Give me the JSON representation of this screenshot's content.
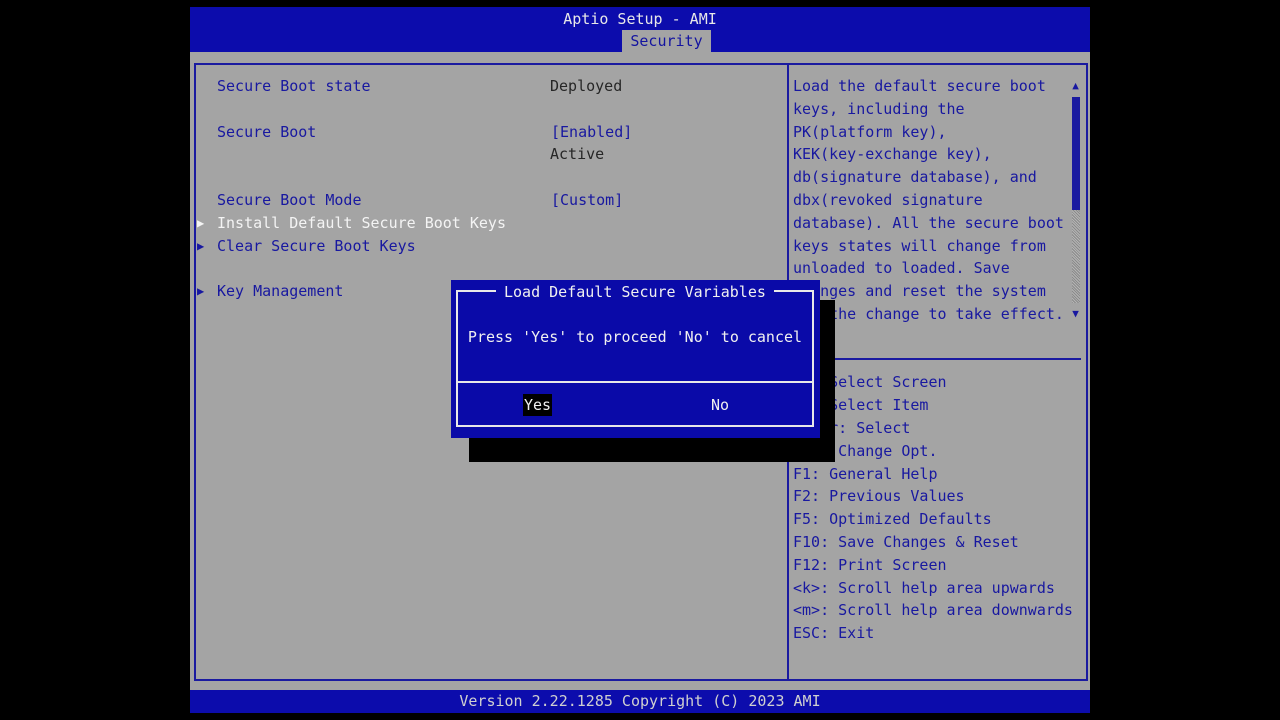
{
  "header": {
    "title": "Aptio Setup - AMI",
    "active_tab": "Security"
  },
  "settings": [
    {
      "label": "Secure Boot state",
      "value": "Deployed"
    },
    {
      "label": "Secure Boot",
      "value": "[Enabled]",
      "status": "Active"
    },
    {
      "label": "Secure Boot Mode",
      "value": "[Custom]"
    },
    {
      "label": "Install Default Secure Boot Keys",
      "submenu": true,
      "selected": true
    },
    {
      "label": "Clear Secure Boot Keys",
      "submenu": true
    },
    {
      "label": "Key Management",
      "submenu": true
    }
  ],
  "help_text": [
    "Load the default secure boot",
    "keys, including the",
    "PK(platform key),",
    "KEK(key-exchange key),",
    "db(signature database), and",
    "dbx(revoked signature",
    "database). All the secure boot",
    "keys states will change from",
    "unloaded to loaded. Save",
    "changes and reset the system",
    "for the change to take effect."
  ],
  "key_help": [
    "→←: Select Screen",
    "↑↓: Select Item",
    "Enter: Select",
    "+/-: Change Opt.",
    "F1: General Help",
    "F2: Previous Values",
    "F5: Optimized Defaults",
    "F10: Save Changes & Reset",
    "F12: Print Screen",
    "<k>: Scroll help area upwards",
    "<m>: Scroll help area downwards",
    "ESC: Exit"
  ],
  "scroll": {
    "up": "▲",
    "down": "▼",
    "position": 0
  },
  "dialog": {
    "title": "Load Default Secure Variables",
    "message": "Press 'Yes' to proceed 'No' to cancel",
    "yes": "Yes",
    "no": "No",
    "selected": "Yes"
  },
  "footer": {
    "text": "Version 2.22.1285 Copyright (C) 2023 AMI"
  },
  "colors": {
    "blue": "#0c0cac",
    "gray": "#a4a4a4",
    "text_blue": "#1818a0"
  }
}
